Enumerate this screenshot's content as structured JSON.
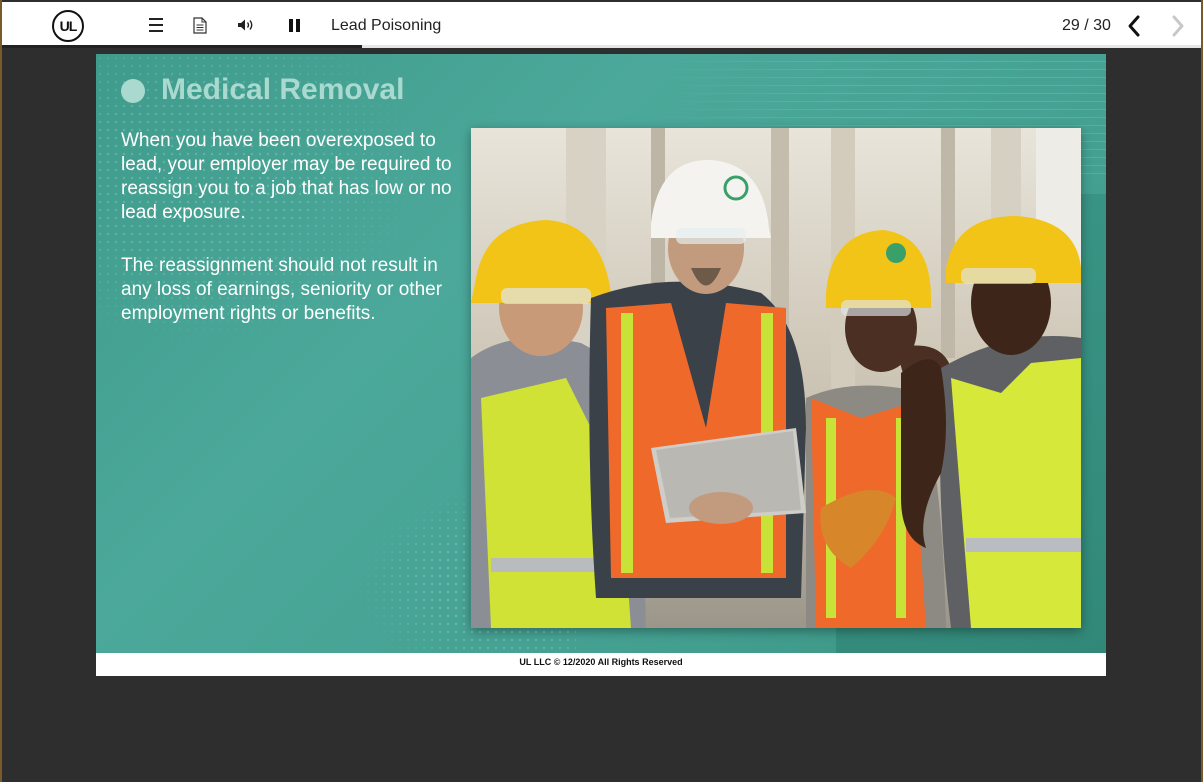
{
  "toolbar": {
    "logo_text": "UL",
    "course_title": "Lead Poisoning",
    "page_counter": "29 / 30",
    "progress": 0.3
  },
  "slide": {
    "title": "Medical Removal",
    "paragraph_1": "When you have been overexposed to lead, your employer may be required to reassign you to a job that has low or no lead exposure.",
    "paragraph_2": "The reassignment should not result in any loss of earnings, seniority or other employment rights or benefits."
  },
  "footer": {
    "copyright": "UL LLC © 12/2020 All Rights Reserved"
  },
  "colors": {
    "slide_teal": "#45a293",
    "title_mint": "#a9d9cf",
    "hard_hat_yellow": "#f2c418",
    "vest_lime": "#d6e83a",
    "vest_orange": "#ef6a2a"
  },
  "icons": [
    "menu-icon",
    "notes-icon",
    "audio-icon",
    "pause-icon",
    "chevron-left-icon",
    "chevron-right-icon"
  ]
}
